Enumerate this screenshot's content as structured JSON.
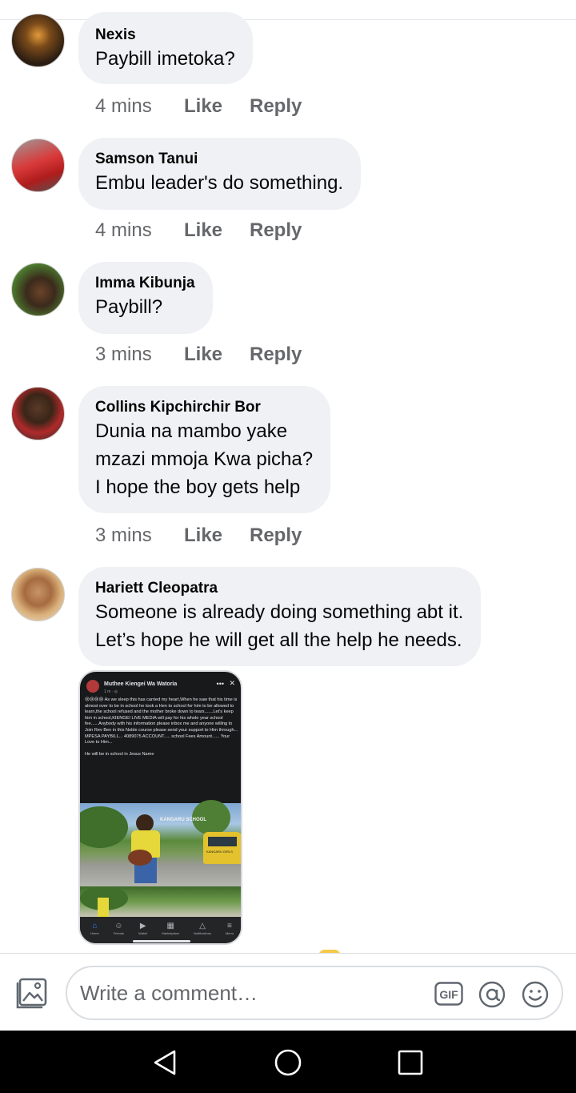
{
  "comments": [
    {
      "author": "Nexis",
      "text": "Paybill imetoka?",
      "time": "4 mins",
      "like": "Like",
      "reply": "Reply"
    },
    {
      "author": "Samson Tanui",
      "text": "Embu leader's  do something.",
      "time": "4 mins",
      "like": "Like",
      "reply": "Reply"
    },
    {
      "author": "Imma Kibunja",
      "text": "Paybill?",
      "time": "3 mins",
      "like": "Like",
      "reply": "Reply"
    },
    {
      "author": "Collins Kipchirchir Bor",
      "text": "Dunia na mambo yake\nmzazi mmoja Kwa picha?\nI hope the boy gets  help",
      "time": "3 mins",
      "like": "Like",
      "reply": "Reply"
    },
    {
      "author": "Hariett Cleopatra",
      "text": "Someone is already doing something abt it.\nLet’s hope he will get all the help he needs."
    }
  ],
  "attachment": {
    "post_author": "Muthee Kiengei Wa Watoria",
    "post_time": "1 m · ",
    "post_text": "😢😢😢😢 As we sleep this has carried my heart,When he saw that his time is almost over to be in school he took a Hen to school for him to be allowed to learn,the school refused and the mother broke down to tears.......Let's keep him in school,KIENGEI LIVE MEDIA will pay for his whole year school fee......Anybody with his information please inbox me and anyone willing to Join Rev Ben in this Noble course please send your support to Him through... MPESA PAYBILL... 4089075 ACCOUNT..... school Fees Amount...... Your Love to Him...",
    "post_text2": "He will be in school in Jesus Name",
    "sign_text": "KANGARU SCHOOL",
    "bus_text": "KANGARU GIRLS",
    "nav": [
      "Home",
      "Friends",
      "Watch",
      "Marketplace",
      "Notifications",
      "Menu"
    ]
  },
  "composer": {
    "placeholder": "Write a comment…",
    "gif_label": "GIF"
  },
  "colors": {
    "bubble": "#eff1f4",
    "meta": "#65676b",
    "text": "#050505",
    "accent": "#2d88ff"
  }
}
